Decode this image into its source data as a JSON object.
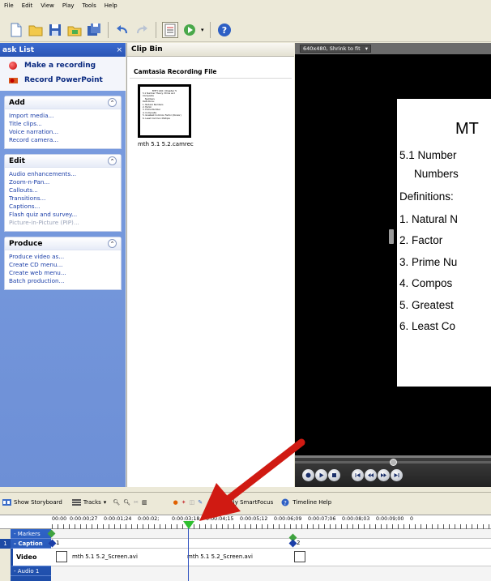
{
  "menu": [
    "File",
    "Edit",
    "View",
    "Play",
    "Tools",
    "Help"
  ],
  "colors": {
    "accent": "#2a55b5",
    "record": "#c20000",
    "link": "#1c3fa8",
    "arrow": "#d01a12",
    "playhead": "#2fbf2f"
  },
  "task_list": {
    "title": "ask List",
    "close": "×",
    "actions": {
      "record": "Make a recording",
      "powerpoint": "Record PowerPoint"
    },
    "groups": {
      "add": {
        "title": "Add",
        "items": [
          "Import media...",
          "Title clips...",
          "Voice narration...",
          "Record camera..."
        ]
      },
      "edit": {
        "title": "Edit",
        "items": [
          "Audio enhancements...",
          "Zoom-n-Pan...",
          "Callouts...",
          "Transitions...",
          "Captions...",
          "Flash quiz and survey...",
          "Picture-in-Picture (PIP)..."
        ]
      },
      "produce": {
        "title": "Produce",
        "items": [
          "Produce video as...",
          "Create CD menu...",
          "Create web menu...",
          "Batch production..."
        ]
      }
    }
  },
  "clip_bin": {
    "title": "Clip Bin",
    "section": "Camtasia Recording File",
    "clip_name": "mth 5.1 5.2.camrec",
    "thumb_title": "MTH 140: Chapter 5",
    "thumb_lines": [
      "5.1 Number Theory: Prime and Composite",
      "Numbers",
      "Definitions:",
      "1. Natural Numbers",
      "2. Factor",
      "3. Prime Number",
      "4. Composite",
      "5. Greatest Common Factor (Divisor)",
      "6. Least Common Multiple"
    ]
  },
  "preview": {
    "size_select": "640x480, Shrink to fit",
    "slide": {
      "title": "MT",
      "lines": [
        "5.1 Number",
        "Numbers",
        "Definitions:",
        "1. Natural N",
        "2. Factor",
        "3. Prime Nu",
        "4. Compos",
        "5. Greatest",
        "6. Least Co"
      ]
    }
  },
  "timeline": {
    "toolbar": {
      "storyboard": "Show Storyboard",
      "tracks": "Tracks",
      "smartfocus": "Apply SmartFocus",
      "help": "Timeline Help"
    },
    "ticks": [
      "00:00",
      "0:00:00;27",
      "0:00:01;24",
      "0:00:02;",
      "0:00:03;18",
      "0:00:04;15",
      "0:00:05;12",
      "0:00:06;09",
      "0:00:07;06",
      "0:00:08;03",
      "0:00:09;00",
      "0"
    ],
    "tracks": {
      "markers": "- Markers",
      "caption": "- Caption",
      "video": "Video",
      "audio": "- Audio 1"
    },
    "track_number": "1",
    "caption_markers": [
      "1",
      "2"
    ],
    "video_clips": [
      "mth 5.1 5.2_Screen.avi",
      "mth 5.1 5.2_Screen.avi"
    ]
  }
}
